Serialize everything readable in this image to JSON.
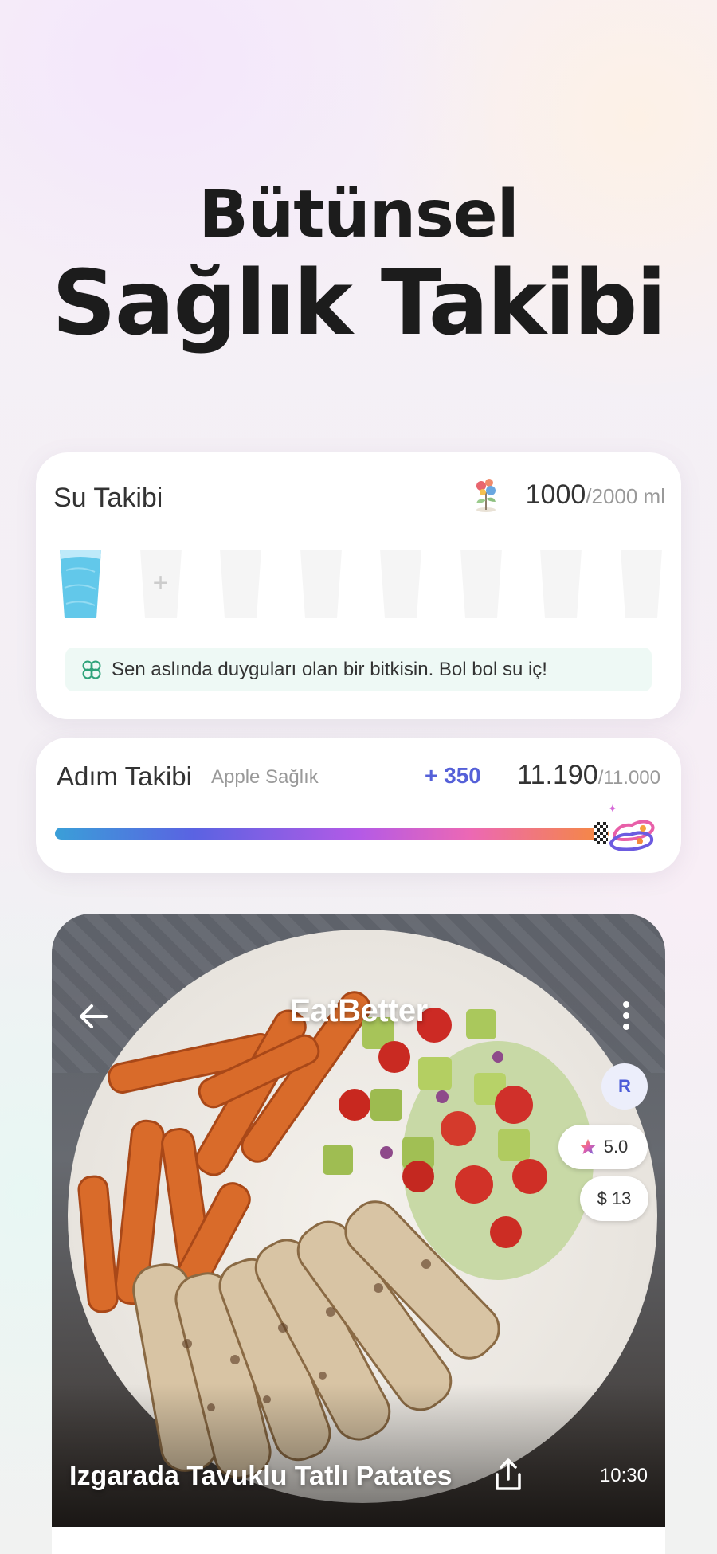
{
  "headline": {
    "line1": "Bütünsel",
    "line2": "Sağlık Takibi"
  },
  "water": {
    "title": "Su Takibi",
    "current": "1000",
    "total": "/2000 ml",
    "add_symbol": "+",
    "tip": "Sen aslında duyguları olan bir bitkisin. Bol bol su iç!",
    "glasses_filled": 1,
    "glasses_total": 8,
    "accent": "#5fc6e8"
  },
  "steps": {
    "title": "Adım Takibi",
    "source": "Apple Sağlık",
    "delta": "+ 350",
    "current": "11.190",
    "total": "/11.000",
    "progress_percent": 100
  },
  "recipe": {
    "brand": "EatBetter",
    "avatar_initial": "R",
    "rating": "5.0",
    "price": "$ 13",
    "title": "Izgarada Tavuklu Tatlı Patates",
    "time": "10:30"
  },
  "icons": {
    "plant": "plant-icon",
    "clover": "clover-icon",
    "back": "arrow-left-icon",
    "menu": "more-vertical-icon",
    "star": "star-icon",
    "share": "share-icon",
    "shoes": "running-shoes-icon",
    "flag": "finish-flag-icon"
  }
}
